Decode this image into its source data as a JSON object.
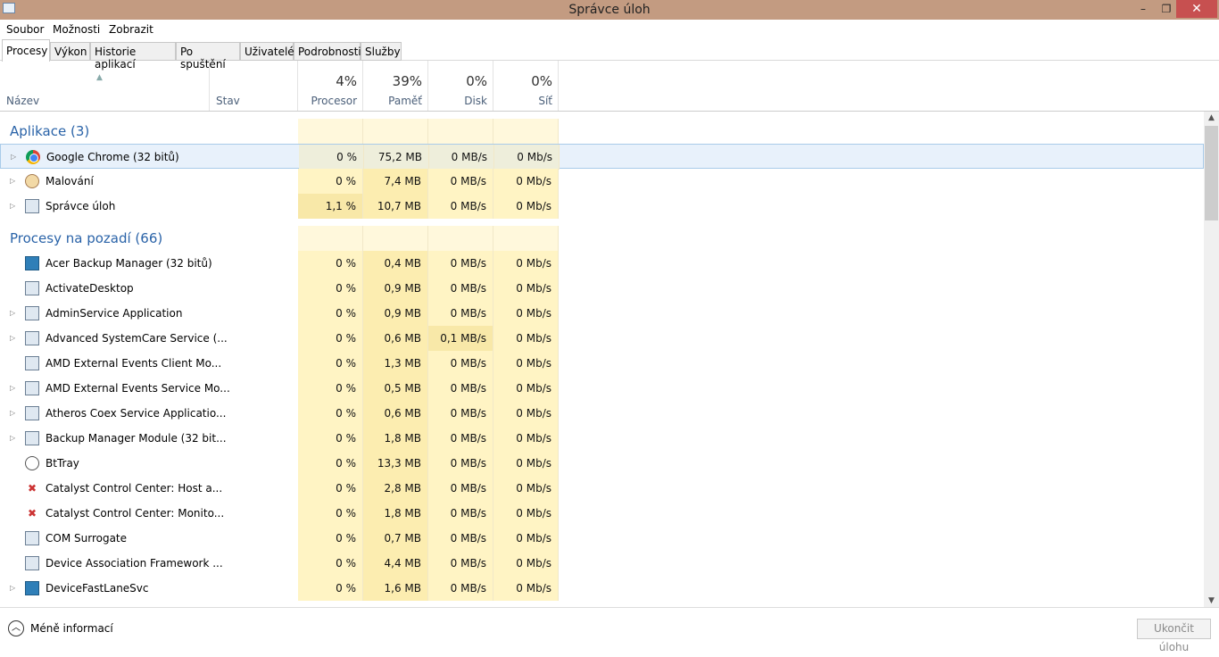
{
  "window": {
    "title": "Správce úloh",
    "minimize": "–",
    "maximize": "❐",
    "close": "✕"
  },
  "menu": [
    "Soubor",
    "Možnosti",
    "Zobrazit"
  ],
  "tabs": [
    "Procesy",
    "Výkon",
    "Historie aplikací",
    "Po spuštění",
    "Uživatelé",
    "Podrobnosti",
    "Služby"
  ],
  "columns": {
    "name": "Název",
    "status": "Stav",
    "cpu": {
      "label": "Procesor",
      "pct": "4%"
    },
    "mem": {
      "label": "Paměť",
      "pct": "39%"
    },
    "disk": {
      "label": "Disk",
      "pct": "0%"
    },
    "net": {
      "label": "Síť",
      "pct": "0%"
    }
  },
  "groups": [
    {
      "title": "Aplikace (3)",
      "rows": [
        {
          "name": "Google Chrome (32 bitů)",
          "icon": "chrome",
          "exp": true,
          "cpu": "0 %",
          "mem": "75,2 MB",
          "disk": "0 MB/s",
          "net": "0 Mb/s",
          "selected": true
        },
        {
          "name": "Malování",
          "icon": "paint",
          "exp": true,
          "cpu": "0 %",
          "mem": "7,4 MB",
          "disk": "0 MB/s",
          "net": "0 Mb/s"
        },
        {
          "name": "Správce úloh",
          "icon": "taskmgr",
          "exp": true,
          "cpu": "1,1 %",
          "mem": "10,7 MB",
          "disk": "0 MB/s",
          "net": "0 Mb/s",
          "hotcpu": true
        }
      ]
    },
    {
      "title": "Procesy na pozadí (66)",
      "rows": [
        {
          "name": "Acer Backup Manager (32 bitů)",
          "icon": "blue",
          "exp": false,
          "cpu": "0 %",
          "mem": "0,4 MB",
          "disk": "0 MB/s",
          "net": "0 Mb/s"
        },
        {
          "name": "ActivateDesktop",
          "icon": "window",
          "exp": false,
          "cpu": "0 %",
          "mem": "0,9 MB",
          "disk": "0 MB/s",
          "net": "0 Mb/s"
        },
        {
          "name": "AdminService Application",
          "icon": "window",
          "exp": true,
          "cpu": "0 %",
          "mem": "0,9 MB",
          "disk": "0 MB/s",
          "net": "0 Mb/s"
        },
        {
          "name": "Advanced SystemCare Service (...",
          "icon": "window",
          "exp": true,
          "cpu": "0 %",
          "mem": "0,6 MB",
          "disk": "0,1 MB/s",
          "net": "0 Mb/s",
          "hotdisk": true
        },
        {
          "name": "AMD External Events Client Mo...",
          "icon": "window",
          "exp": false,
          "cpu": "0 %",
          "mem": "1,3 MB",
          "disk": "0 MB/s",
          "net": "0 Mb/s"
        },
        {
          "name": "AMD External Events Service Mo...",
          "icon": "window",
          "exp": true,
          "cpu": "0 %",
          "mem": "0,5 MB",
          "disk": "0 MB/s",
          "net": "0 Mb/s"
        },
        {
          "name": "Atheros Coex Service Applicatio...",
          "icon": "window",
          "exp": true,
          "cpu": "0 %",
          "mem": "0,6 MB",
          "disk": "0 MB/s",
          "net": "0 Mb/s"
        },
        {
          "name": "Backup Manager Module (32 bit...",
          "icon": "window",
          "exp": true,
          "cpu": "0 %",
          "mem": "1,8 MB",
          "disk": "0 MB/s",
          "net": "0 Mb/s"
        },
        {
          "name": "BtTray",
          "icon": "bt",
          "exp": false,
          "cpu": "0 %",
          "mem": "13,3 MB",
          "disk": "0 MB/s",
          "net": "0 Mb/s"
        },
        {
          "name": "Catalyst Control Center: Host a...",
          "icon": "ccc",
          "exp": false,
          "cpu": "0 %",
          "mem": "2,8 MB",
          "disk": "0 MB/s",
          "net": "0 Mb/s"
        },
        {
          "name": "Catalyst Control Center: Monito...",
          "icon": "ccc",
          "exp": false,
          "cpu": "0 %",
          "mem": "1,8 MB",
          "disk": "0 MB/s",
          "net": "0 Mb/s"
        },
        {
          "name": "COM Surrogate",
          "icon": "window",
          "exp": false,
          "cpu": "0 %",
          "mem": "0,7 MB",
          "disk": "0 MB/s",
          "net": "0 Mb/s"
        },
        {
          "name": "Device Association Framework ...",
          "icon": "window",
          "exp": false,
          "cpu": "0 %",
          "mem": "4,4 MB",
          "disk": "0 MB/s",
          "net": "0 Mb/s"
        },
        {
          "name": "DeviceFastLaneSvc",
          "icon": "blue",
          "exp": true,
          "cpu": "0 %",
          "mem": "1,6 MB",
          "disk": "0 MB/s",
          "net": "0 Mb/s"
        }
      ]
    }
  ],
  "footer": {
    "less": "Méně informací",
    "end_task": "Ukončit úlohu"
  }
}
